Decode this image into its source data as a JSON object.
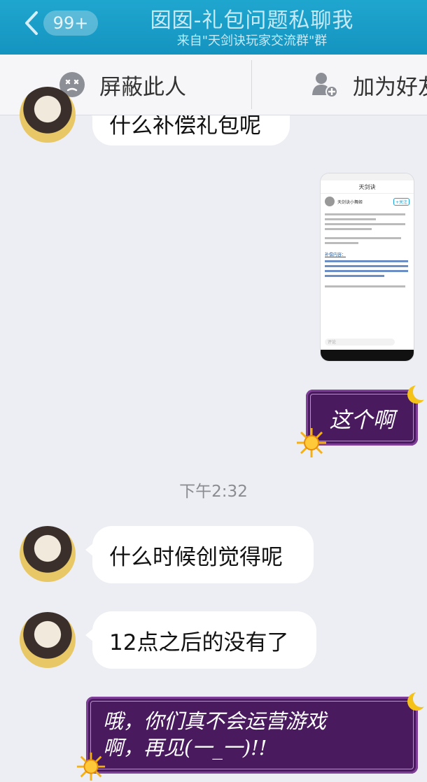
{
  "header": {
    "back_badge": "99+",
    "title": "囡囡-礼包问题私聊我",
    "subtitle": "来自\"天剑诀玩家交流群\"群"
  },
  "actions": {
    "block_label": "屏蔽此人",
    "add_friend_label": "加为好友"
  },
  "messages": {
    "partial_top": "什么补偿礼包呢",
    "self_reply_1": "这个啊",
    "timestamp": "下午2:32",
    "msg_when": "什么时候创觉得呢",
    "msg_after12": "12点之后的没有了",
    "self_reply_2_line1": "哦，你们真不会运营游戏",
    "self_reply_2_line2": "啊，再见(一_一)!!"
  },
  "screenshot_card": {
    "app_title": "天剑诀",
    "author": "天剑诀小舞姬",
    "follow": "+关注",
    "highlight": "补偿内容：",
    "input_placeholder": "评论"
  },
  "colors": {
    "header_bg": "#1494c0",
    "bubble_purple": "#4a1a5e",
    "chat_bg": "#eceef3"
  }
}
